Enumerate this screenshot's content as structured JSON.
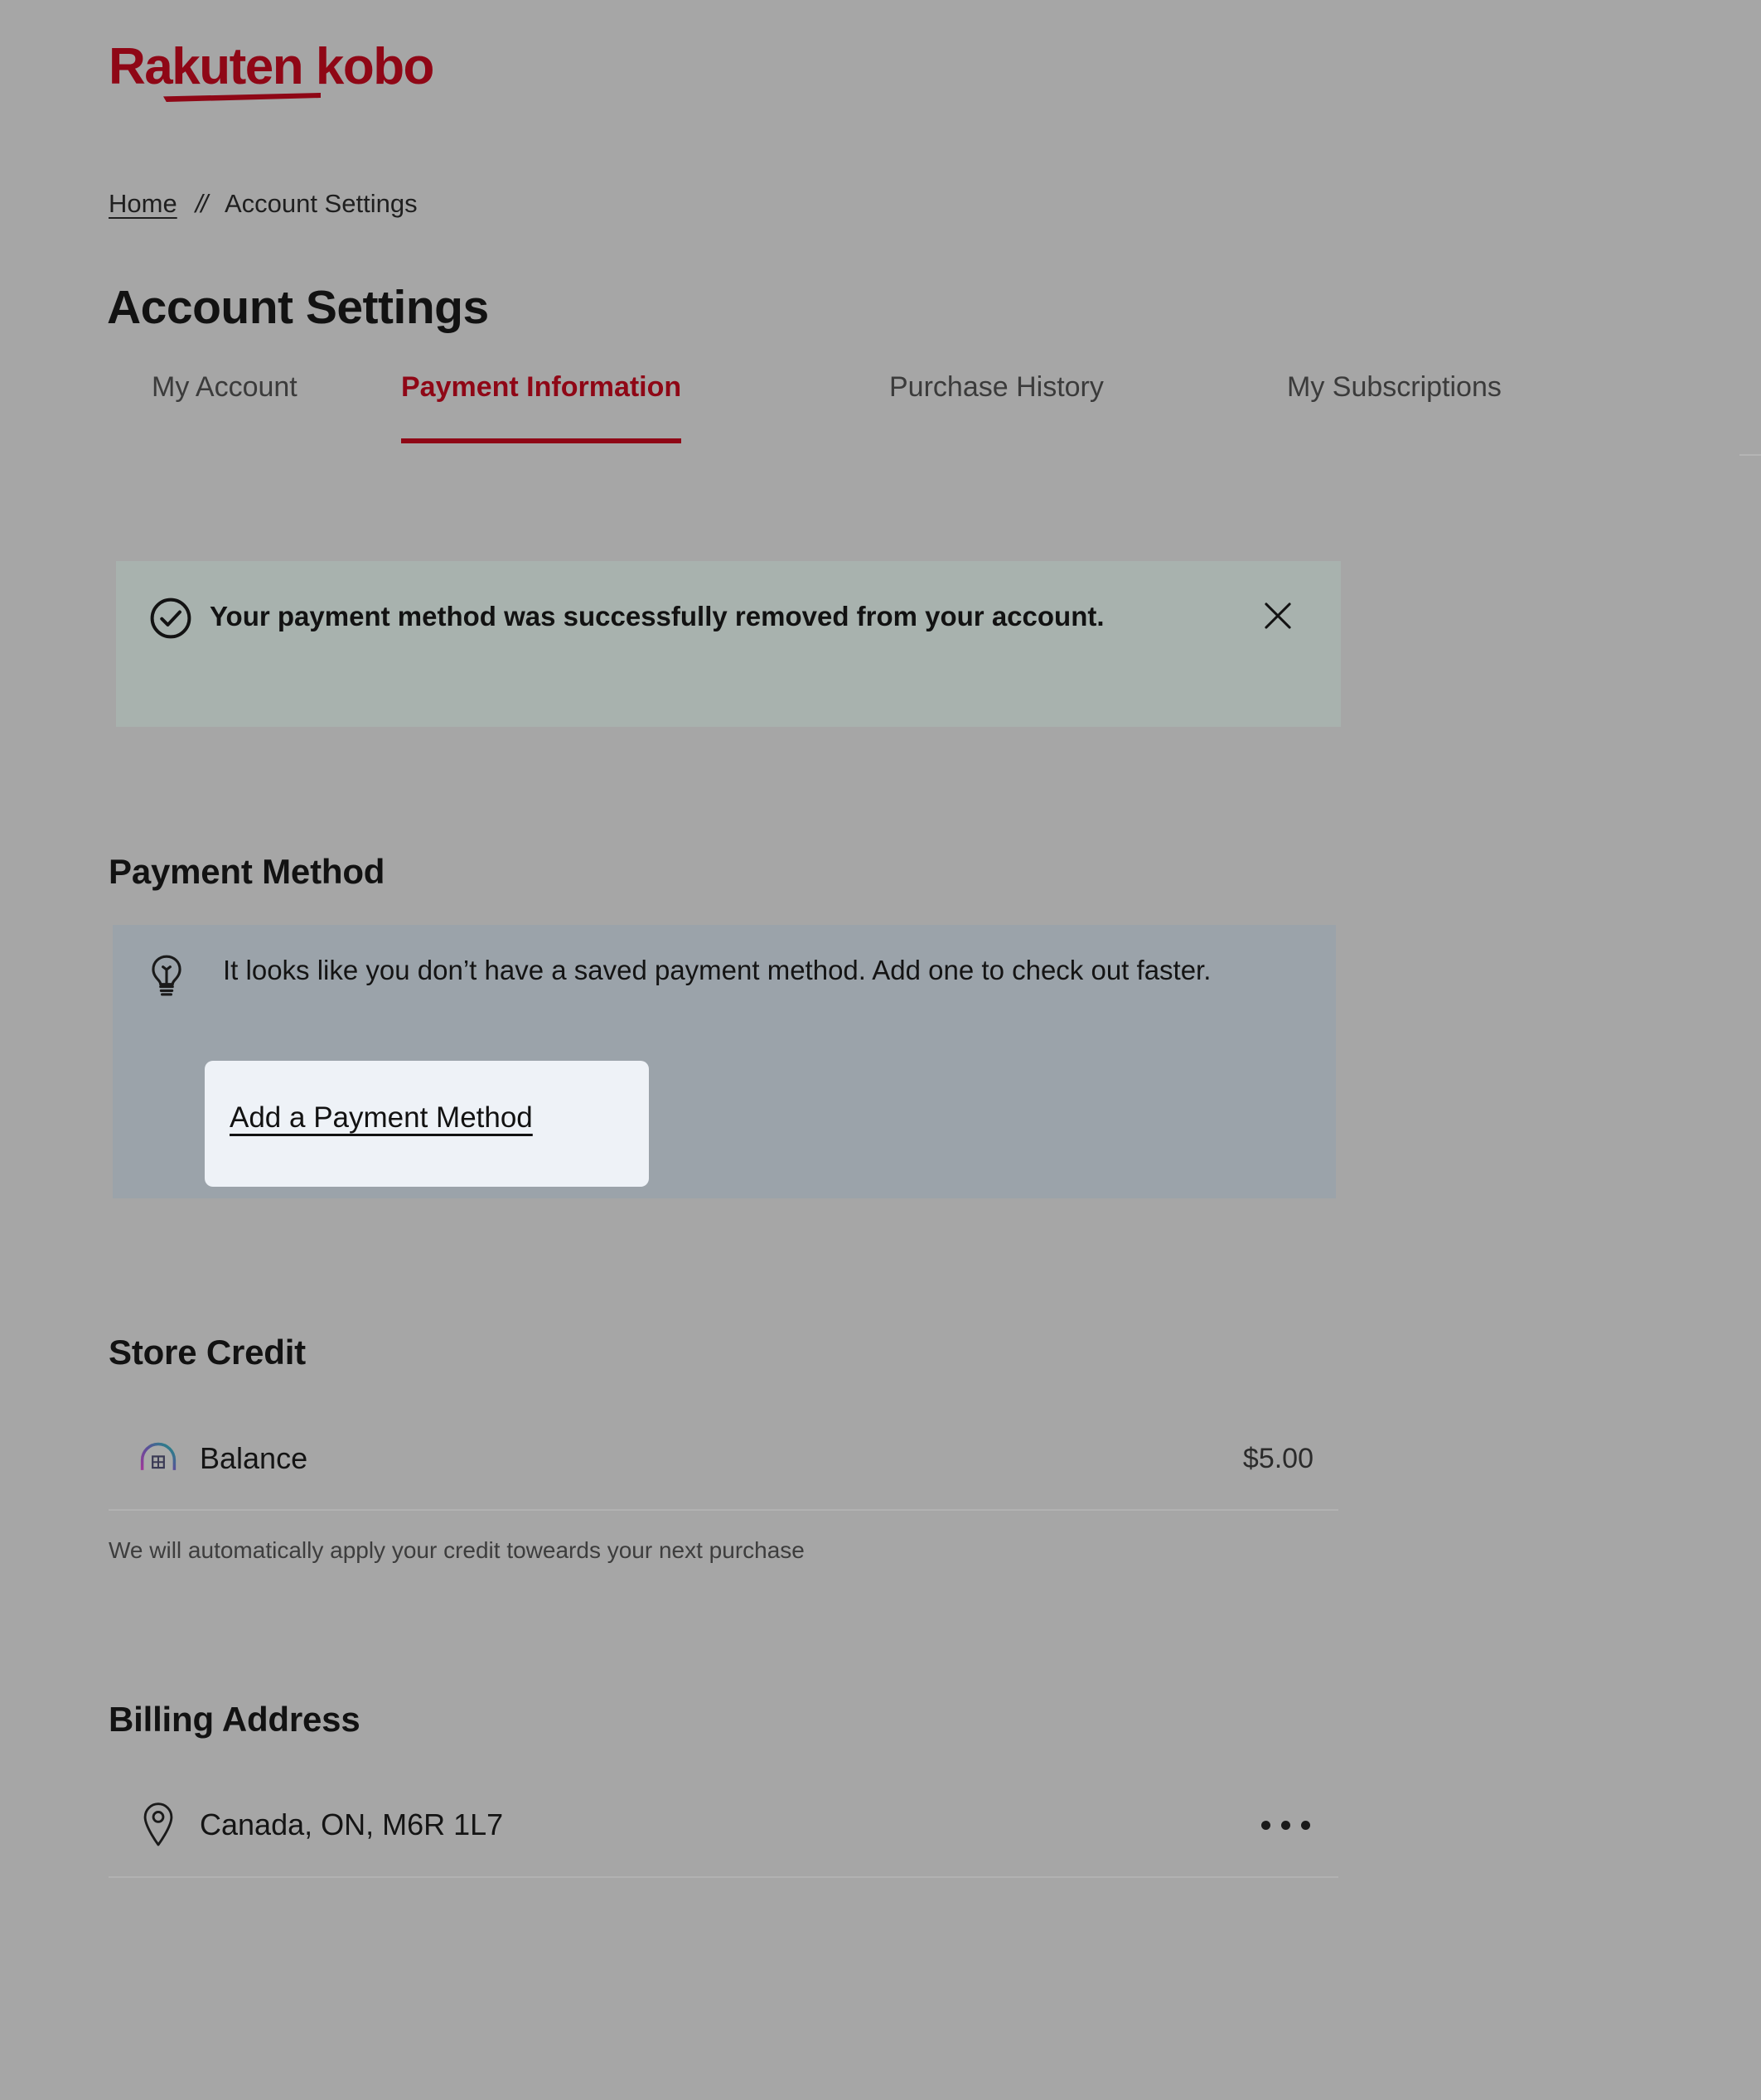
{
  "brand": {
    "logo_text": "Rakuten kobo",
    "logo_color": "#8f0716"
  },
  "breadcrumb": {
    "home_label": "Home",
    "separator": "//",
    "current_label": "Account Settings"
  },
  "header": {
    "title": "Account Settings"
  },
  "tabs": [
    {
      "label": "My Account",
      "active": false
    },
    {
      "label": "Payment Information",
      "active": true
    },
    {
      "label": "Purchase History",
      "active": false
    },
    {
      "label": "My Subscriptions",
      "active": false
    }
  ],
  "alert": {
    "icon": "check-circle-icon",
    "message": "Your payment method was successfully removed from your account.",
    "close_icon": "close-icon",
    "background": "#a8b2ae"
  },
  "payment_method": {
    "heading": "Payment Method",
    "icon": "lightbulb-icon",
    "empty_message": "It looks like you don’t have a saved payment method. Add one to check out faster.",
    "add_link_label": "Add a Payment Method",
    "box_background": "#9ba3aa",
    "highlight_background": "#eef2f7"
  },
  "store_credit": {
    "heading": "Store Credit",
    "icon": "store-credit-icon",
    "balance_label": "Balance",
    "balance_value": "$5.00",
    "helper_text": "We will automatically apply your credit toweards your next purchase"
  },
  "billing_address": {
    "heading": "Billing Address",
    "icon": "map-pin-icon",
    "address": "Canada, ON, M6R 1L7",
    "menu_icon": "more-options-icon"
  }
}
